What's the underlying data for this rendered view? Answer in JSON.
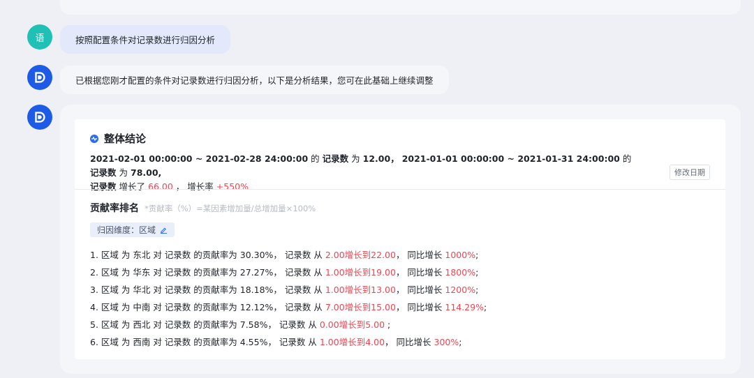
{
  "chat": {
    "user_avatar_text": "语",
    "user_message": "按照配置条件对记录数进行归因分析",
    "bot_message": "已根据您刚才配置的条件对记录数进行归因分析，以下是分析结果，您可在此基础上继续调整",
    "bot_avatar_icon": "bot-logo-icon"
  },
  "result": {
    "section1_title": "整体结论",
    "summary": {
      "range1": "2021-02-01 00:00:00 ~ 2021-02-28 24:00:00",
      "de1": "的",
      "metric1": "记录数",
      "wei1": "为",
      "value1": "12.00，",
      "range2": "2021-01-01 00:00:00 ~ 2021-01-31 24:00:00",
      "de2": "的",
      "metric2": "记录数",
      "wei2": "为",
      "value2": "78.00,",
      "metric3": "记录数",
      "increase_label": "增长了",
      "increase_value": "66.00",
      "sep": "，",
      "rate_label": "增长率",
      "rate_value": "+550%"
    },
    "edit_date_button": "修改日期",
    "section2_title": "贡献率排名",
    "section2_note": "*贡献率（%）=某因素增加量/总增加量×100%",
    "dimension_tag": "归因维度：区域",
    "rank_items": [
      {
        "prefix": "1. 区域 为 东北 对 记录数 的贡献率为 30.30%，  记录数 从 ",
        "change": "2.00增长到22.00",
        "mid": "，  同比增长 ",
        "yoy": "1000%",
        "suffix": ";"
      },
      {
        "prefix": "2. 区域 为 华东 对 记录数 的贡献率为 27.27%，  记录数 从 ",
        "change": "1.00增长到19.00",
        "mid": "，  同比增长 ",
        "yoy": "1800%",
        "suffix": ";"
      },
      {
        "prefix": "3. 区域 为 华北 对 记录数 的贡献率为 18.18%，  记录数 从 ",
        "change": "1.00增长到13.00",
        "mid": "，  同比增长 ",
        "yoy": "1200%",
        "suffix": ";"
      },
      {
        "prefix": "4. 区域 为 中南 对 记录数 的贡献率为 12.12%，  记录数 从 ",
        "change": "7.00增长到15.00",
        "mid": "，  同比增长 ",
        "yoy": "114.29%",
        "suffix": ";"
      },
      {
        "prefix": "5. 区域 为 西北 对 记录数 的贡献率为 7.58%，  记录数 从 ",
        "change": "0.00增长到5.00",
        "mid": "",
        "yoy": "",
        "suffix": " ;"
      },
      {
        "prefix": "6. 区域 为 西南 对 记录数 的贡献率为 4.55%，  记录数 从 ",
        "change": "1.00增长到4.00",
        "mid": "，  同比增长 ",
        "yoy": "300%",
        "suffix": ";"
      }
    ]
  },
  "colors": {
    "accent": "#1d5be6",
    "user_avatar": "#1fc0b5",
    "highlight_red": "#f5424f"
  }
}
